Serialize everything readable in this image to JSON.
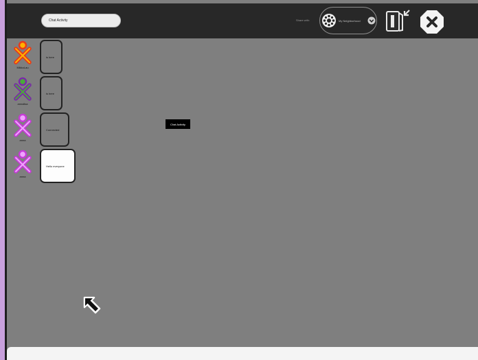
{
  "toolbar": {
    "title_value": "Chat Activity",
    "share_label": "Share with:",
    "share_value": "My Neighborhood"
  },
  "messages": [
    {
      "buddy": "MikkoLau",
      "text": "is here",
      "stroke": "#e83a1a",
      "fill": "#ffb000",
      "style": "dark"
    },
    {
      "buddy": "annalisa",
      "text": "is here",
      "stroke": "#7a2aa8",
      "fill": "#4aaa3a",
      "style": "dark"
    },
    {
      "buddy": "anna",
      "text": "Connected",
      "stroke": "#c53bd6",
      "fill": "#f0a2ff",
      "style": "dark"
    },
    {
      "buddy": "anna",
      "text": "Hello everyone",
      "stroke": "#c53bd6",
      "fill": "#f0a2ff",
      "style": "light"
    }
  ],
  "tooltip": "Chat Activity",
  "colors": {
    "canvas": "#7f7f7f",
    "toolbar": "#282828"
  }
}
